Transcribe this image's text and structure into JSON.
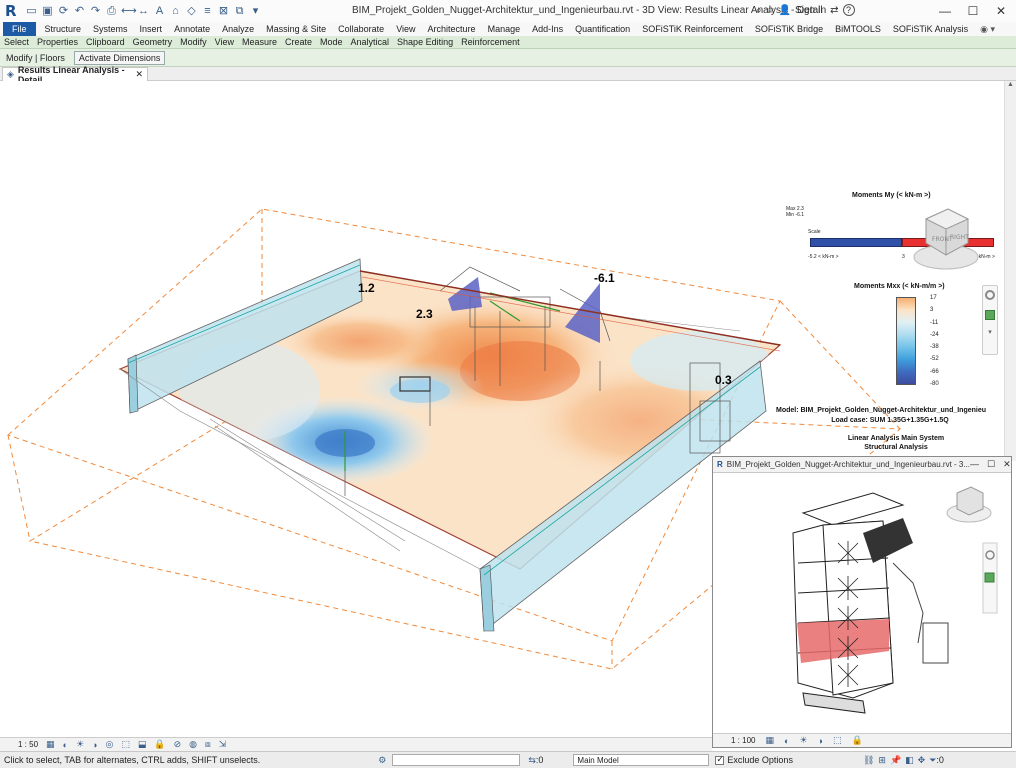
{
  "app": {
    "title": "BIM_Projekt_Golden_Nugget-Architektur_und_Ingenieurbau.rvt - 3D View: Results Linear Analysis - Detail",
    "sign_in": "Sign In",
    "help": "?"
  },
  "ribbon": {
    "tabs": [
      "File",
      "Structure",
      "Systems",
      "Insert",
      "Annotate",
      "Analyze",
      "Massing & Site",
      "Collaborate",
      "View",
      "Architecture",
      "Manage",
      "Add-Ins",
      "Quantification",
      "SOFiSTiK Reinforcement",
      "SOFiSTiK Bridge",
      "BiMTOOLS",
      "SOFiSTiK Analysis"
    ],
    "panels": [
      "Select",
      "Properties",
      "Clipboard",
      "Geometry",
      "Modify",
      "View",
      "Measure",
      "Create",
      "Mode",
      "Analytical",
      "Shape Editing",
      "Reinforcement"
    ]
  },
  "context": {
    "label": "Modify | Floors",
    "activate_dimensions": "Activate Dimensions"
  },
  "view_tab": {
    "label": "Results Linear Analysis - Detail",
    "close": "✕"
  },
  "value_labels": [
    "1.2",
    "2.3",
    "-6.1",
    "0.3"
  ],
  "legend_my": {
    "title": "Moments My (< kN-m >)",
    "max": "Max 2.3",
    "min": "Min -6.1",
    "scale_label": "Scale",
    "left_tick": "-5.2 < kN-m >",
    "mid_tick": "3",
    "right_tick": "2.2 < kN-m >",
    "colors": [
      "#3050a8",
      "#e83030"
    ]
  },
  "legend_mxx": {
    "title": "Moments Mxx (< kN-m/m >)",
    "ticks": [
      "17",
      "3",
      "-11",
      "-24",
      "-38",
      "-52",
      "-66",
      "-80"
    ],
    "colors": [
      "#f6b070",
      "#fbe3c8",
      "#dff0f5",
      "#aedcf0",
      "#73c3e8",
      "#3f9fdc",
      "#3f6cbf",
      "#3d4c9e"
    ]
  },
  "model_info": {
    "model": "Model: BIM_Projekt_Golden_Nugget-Architektur_und_Ingenieu",
    "load_case": "Load case: SUM 1.35G+1.35G+1.5Q",
    "system": "Linear Analysis Main System",
    "analysis": "Structural Analysis"
  },
  "inset": {
    "title": "BIM_Projekt_Golden_Nugget-Architektur_und_Ingenieurbau.rvt - 3...",
    "scale": "1 : 100"
  },
  "view_control": {
    "scale": "1 : 50"
  },
  "status": {
    "text": "Click to select, TAB for alternates, CTRL adds, SHIFT unselects.",
    "workset_value": ":0",
    "model": "Main Model",
    "exclude_options": "Exclude Options",
    "filter_count": ":0"
  }
}
